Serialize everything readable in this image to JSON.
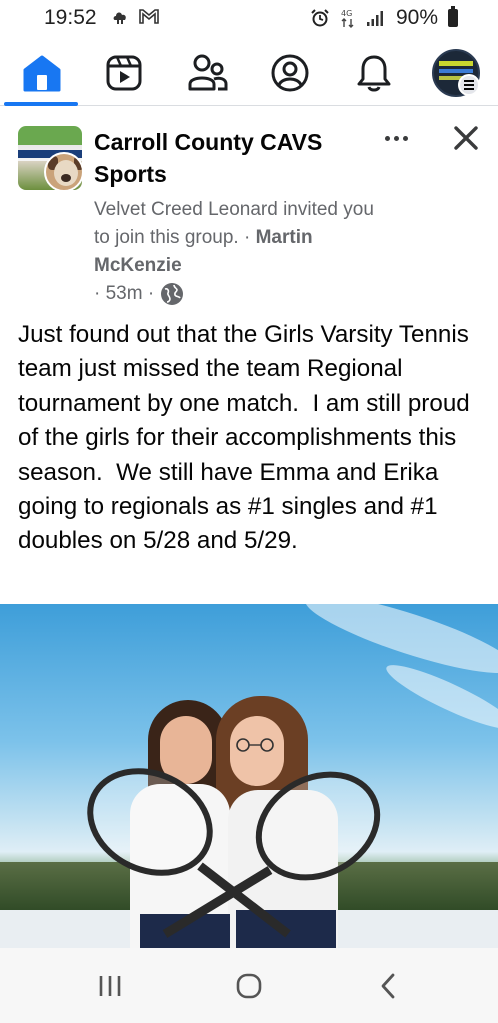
{
  "status_bar": {
    "time": "19:52",
    "battery": "90%",
    "notification_icons": [
      "cloud-icon",
      "gmail-icon"
    ],
    "system_icons": [
      "alarm-icon",
      "data-icon",
      "signal-icon",
      "battery-icon"
    ]
  },
  "nav": {
    "items": [
      {
        "name": "home",
        "icon": "home-icon",
        "active": true
      },
      {
        "name": "watch",
        "icon": "video-icon",
        "active": false
      },
      {
        "name": "friends",
        "icon": "friends-icon",
        "active": false
      },
      {
        "name": "profile",
        "icon": "profile-icon",
        "active": false
      },
      {
        "name": "notifications",
        "icon": "bell-icon",
        "active": false
      },
      {
        "name": "menu",
        "icon": "menu-avatar-icon",
        "active": false
      }
    ],
    "accent": "#1877f2"
  },
  "post": {
    "group_name": "Carroll County CAVS Sports",
    "invite_text": "Velvet Creed Leonard invited you to join this group. · ",
    "poster_name": "Martin McKenzie",
    "time_ago": "· 53m ·",
    "privacy_icon": "globe-icon",
    "body": "Just found out that the Girls Varsity Tennis team just missed the team Regional tournament by one match.  I am still proud of the girls for their accomplishments this season.  We still have Emma and Erika going to regionals as #1 singles and #1 doubles on 5/28 and 5/29.",
    "photo_icon": "tennis-photo"
  },
  "system_nav": {
    "buttons": [
      "recents-icon",
      "home-circle-icon",
      "back-icon"
    ]
  }
}
